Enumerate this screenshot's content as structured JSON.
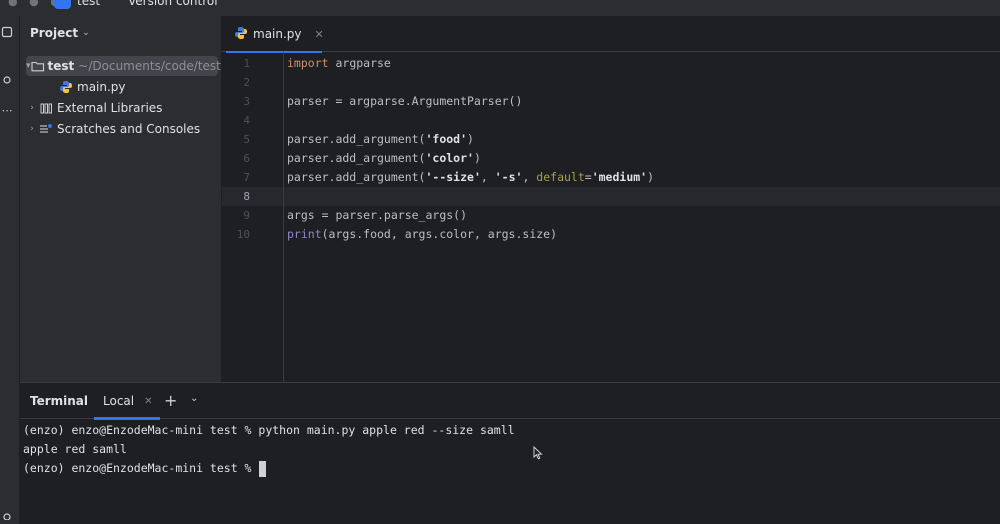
{
  "titlebar": {
    "project_name": "test",
    "vcs_label": "Version control"
  },
  "project_panel": {
    "title": "Project",
    "tree": [
      {
        "label": "test",
        "path": "~/Documents/code/test",
        "type": "folder",
        "expanded": true,
        "selected": true
      },
      {
        "label": "main.py",
        "type": "python-file"
      },
      {
        "label": "External Libraries",
        "type": "library"
      },
      {
        "label": "Scratches and Consoles",
        "type": "scratches"
      }
    ]
  },
  "editor": {
    "tab_label": "main.py",
    "current_line": 8,
    "line_numbers": [
      "1",
      "2",
      "3",
      "4",
      "5",
      "6",
      "7",
      "8",
      "9",
      "10"
    ],
    "lines": [
      {
        "n": "1",
        "tokens": [
          {
            "t": "import",
            "c": "kw"
          },
          {
            "t": " argparse",
            "c": "plain"
          }
        ]
      },
      {
        "n": "2",
        "tokens": []
      },
      {
        "n": "3",
        "tokens": [
          {
            "t": "parser = argparse.ArgumentParser()",
            "c": "plain"
          }
        ]
      },
      {
        "n": "4",
        "tokens": []
      },
      {
        "n": "5",
        "tokens": [
          {
            "t": "parser.add_argument(",
            "c": "plain"
          },
          {
            "t": "'food'",
            "c": "strb"
          },
          {
            "t": ")",
            "c": "plain"
          }
        ]
      },
      {
        "n": "6",
        "tokens": [
          {
            "t": "parser.add_argument(",
            "c": "plain"
          },
          {
            "t": "'color'",
            "c": "strb"
          },
          {
            "t": ")",
            "c": "plain"
          }
        ]
      },
      {
        "n": "7",
        "tokens": [
          {
            "t": "parser.add_argument(",
            "c": "plain"
          },
          {
            "t": "'--size'",
            "c": "strb"
          },
          {
            "t": ", ",
            "c": "plain"
          },
          {
            "t": "'-s'",
            "c": "strb"
          },
          {
            "t": ", ",
            "c": "plain"
          },
          {
            "t": "default",
            "c": "prm"
          },
          {
            "t": "=",
            "c": "plain"
          },
          {
            "t": "'medium'",
            "c": "strb"
          },
          {
            "t": ")",
            "c": "plain"
          }
        ]
      },
      {
        "n": "8",
        "tokens": []
      },
      {
        "n": "9",
        "tokens": [
          {
            "t": "args = parser.parse_args()",
            "c": "plain"
          }
        ]
      },
      {
        "n": "10",
        "tokens": [
          {
            "t": "print",
            "c": "bi"
          },
          {
            "t": "(args.food, args.color, args.size)",
            "c": "plain"
          }
        ]
      }
    ]
  },
  "terminal": {
    "title": "Terminal",
    "tab_label": "Local",
    "lines": [
      "(enzo) enzo@EnzodeMac-mini test % python main.py apple red --size samll",
      "apple red samll",
      "(enzo) enzo@EnzodeMac-mini test % "
    ]
  },
  "colors": {
    "accent": "#3574f0",
    "keyword": "#cf8e6d",
    "builtin": "#8888c6",
    "named_param": "#aa9e43",
    "background": "#1e1f22",
    "panel": "#2b2d30"
  }
}
